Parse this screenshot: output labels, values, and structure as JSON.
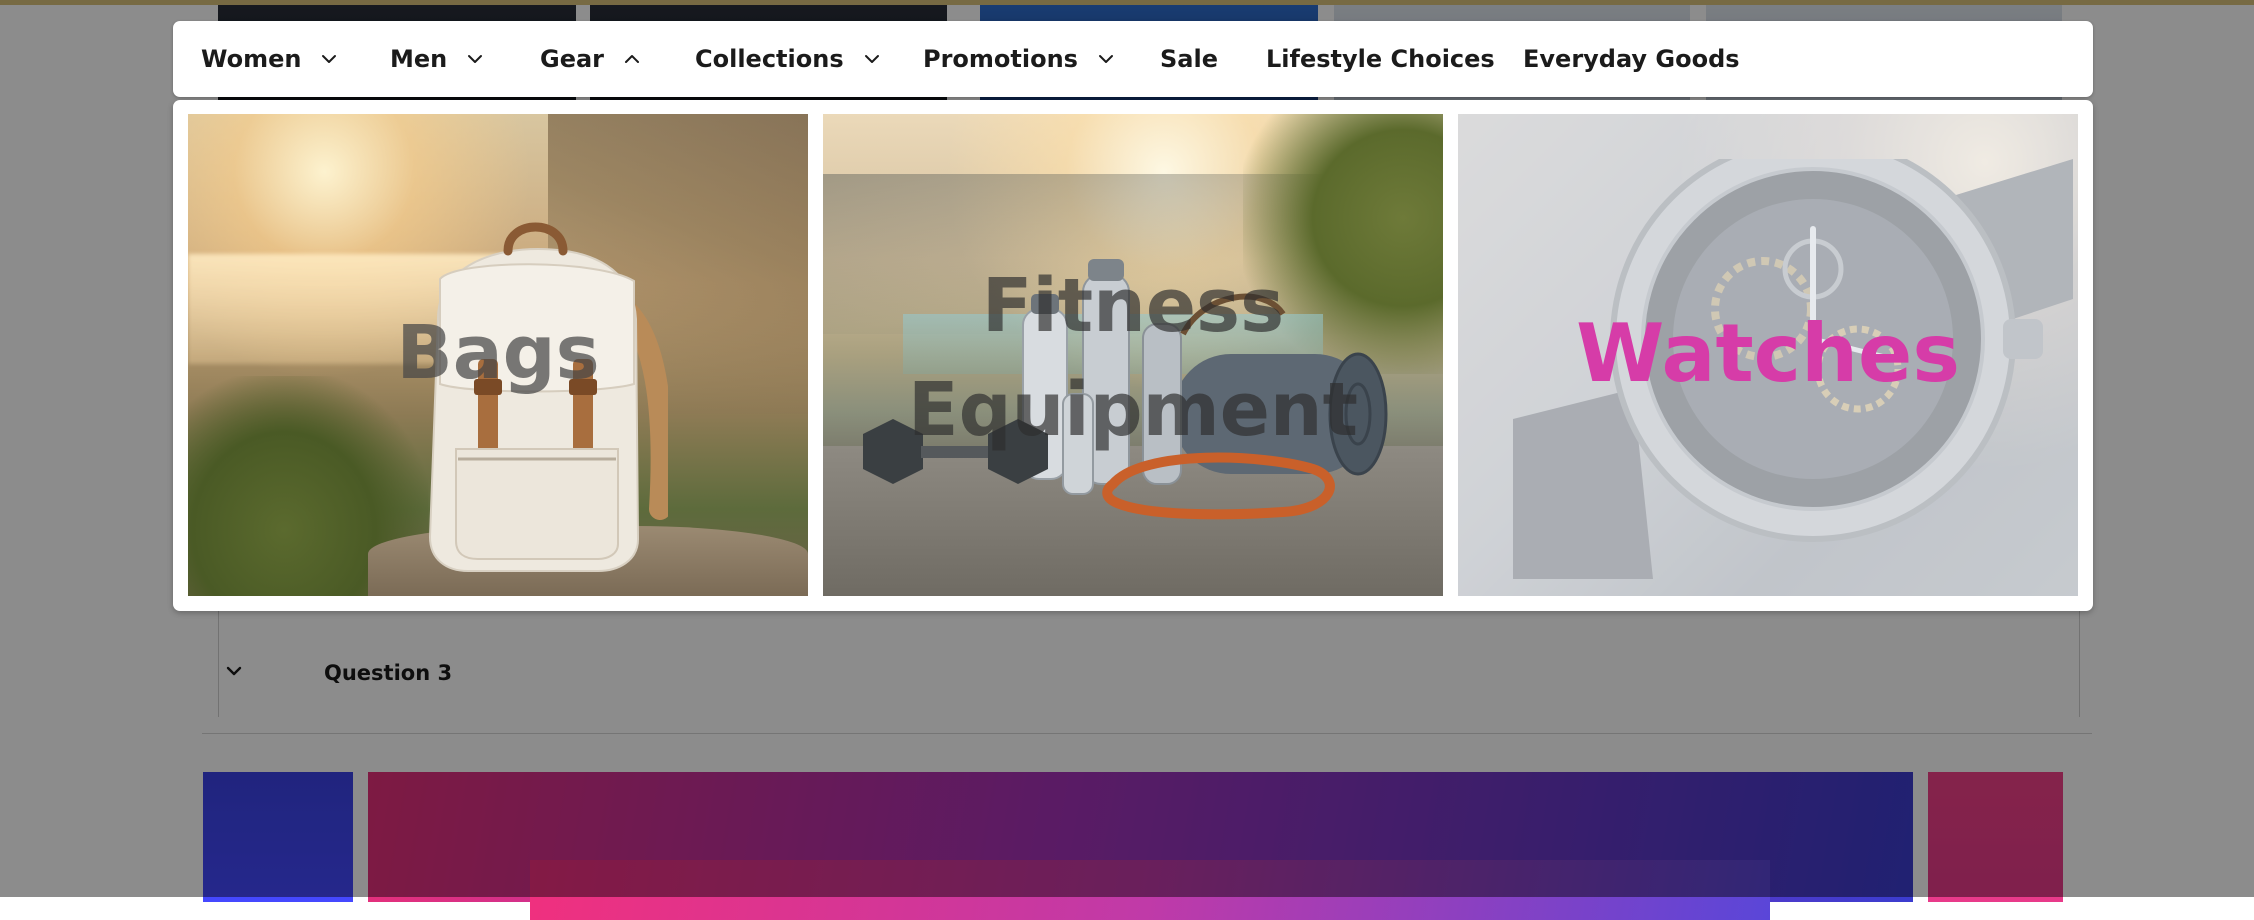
{
  "nav": {
    "items": [
      {
        "label": "Women",
        "has_chevron": true,
        "expanded": false
      },
      {
        "label": "Men",
        "has_chevron": true,
        "expanded": false
      },
      {
        "label": "Gear",
        "has_chevron": true,
        "expanded": true
      },
      {
        "label": "Collections",
        "has_chevron": true,
        "expanded": false
      },
      {
        "label": "Promotions",
        "has_chevron": true,
        "expanded": false
      },
      {
        "label": "Sale",
        "has_chevron": false,
        "expanded": false
      },
      {
        "label": "Lifestyle Choices",
        "has_chevron": false,
        "expanded": false
      },
      {
        "label": "Everyday Goods",
        "has_chevron": false,
        "expanded": false
      }
    ]
  },
  "mega_menu": {
    "cards": [
      {
        "label": "Bags",
        "icon": "backpack-image"
      },
      {
        "label": "Fitness Equipment",
        "icon": "fitness-gear-image"
      },
      {
        "label": "Watches",
        "icon": "watch-image"
      }
    ]
  },
  "background": {
    "faq": {
      "question": "Question 3"
    }
  },
  "colors": {
    "overlay": "rgba(0,0,0,0.45)",
    "watches_label": "#d63ca8",
    "nav_text": "#1b1b1b"
  }
}
